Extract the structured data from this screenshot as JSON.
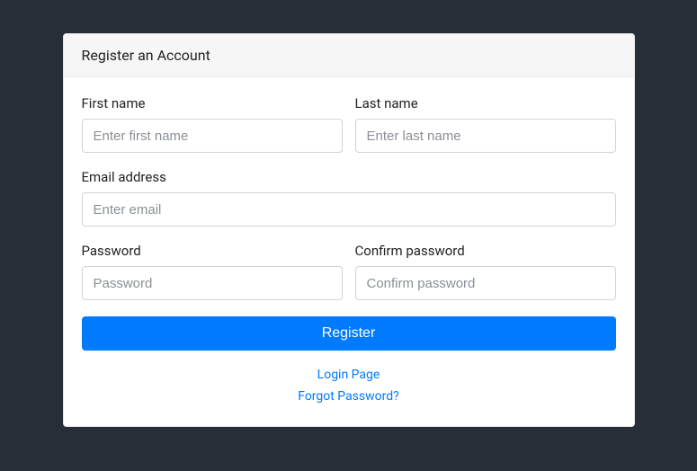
{
  "card": {
    "header": "Register an Account"
  },
  "form": {
    "first_name": {
      "label": "First name",
      "placeholder": "Enter first name"
    },
    "last_name": {
      "label": "Last name",
      "placeholder": "Enter last name"
    },
    "email": {
      "label": "Email address",
      "placeholder": "Enter email"
    },
    "password": {
      "label": "Password",
      "placeholder": "Password"
    },
    "confirm_password": {
      "label": "Confirm password",
      "placeholder": "Confirm password"
    },
    "submit_label": "Register"
  },
  "links": {
    "login": "Login Page",
    "forgot": "Forgot Password?"
  }
}
